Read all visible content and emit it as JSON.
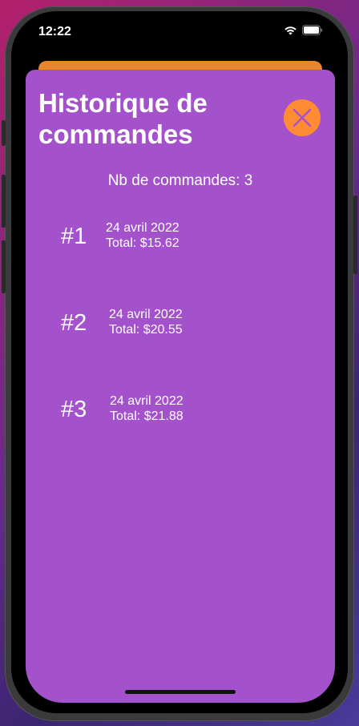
{
  "status": {
    "time": "12:22"
  },
  "sheet": {
    "title": "Historique de commandes",
    "close_icon": "close-x-icon",
    "count_text": "Nb de commandes: 3"
  },
  "orders": [
    {
      "number": "#1",
      "date": "24 avril 2022",
      "total": "Total: $15.62"
    },
    {
      "number": "#2",
      "date": "24 avril 2022",
      "total": "Total: $20.55"
    },
    {
      "number": "#3",
      "date": "24 avril 2022",
      "total": "Total: $21.88"
    }
  ],
  "colors": {
    "sheet": "#a352cc",
    "accent": "#ff8c33",
    "close_x": "#a352cc",
    "background_sheet": "#e8862a"
  }
}
